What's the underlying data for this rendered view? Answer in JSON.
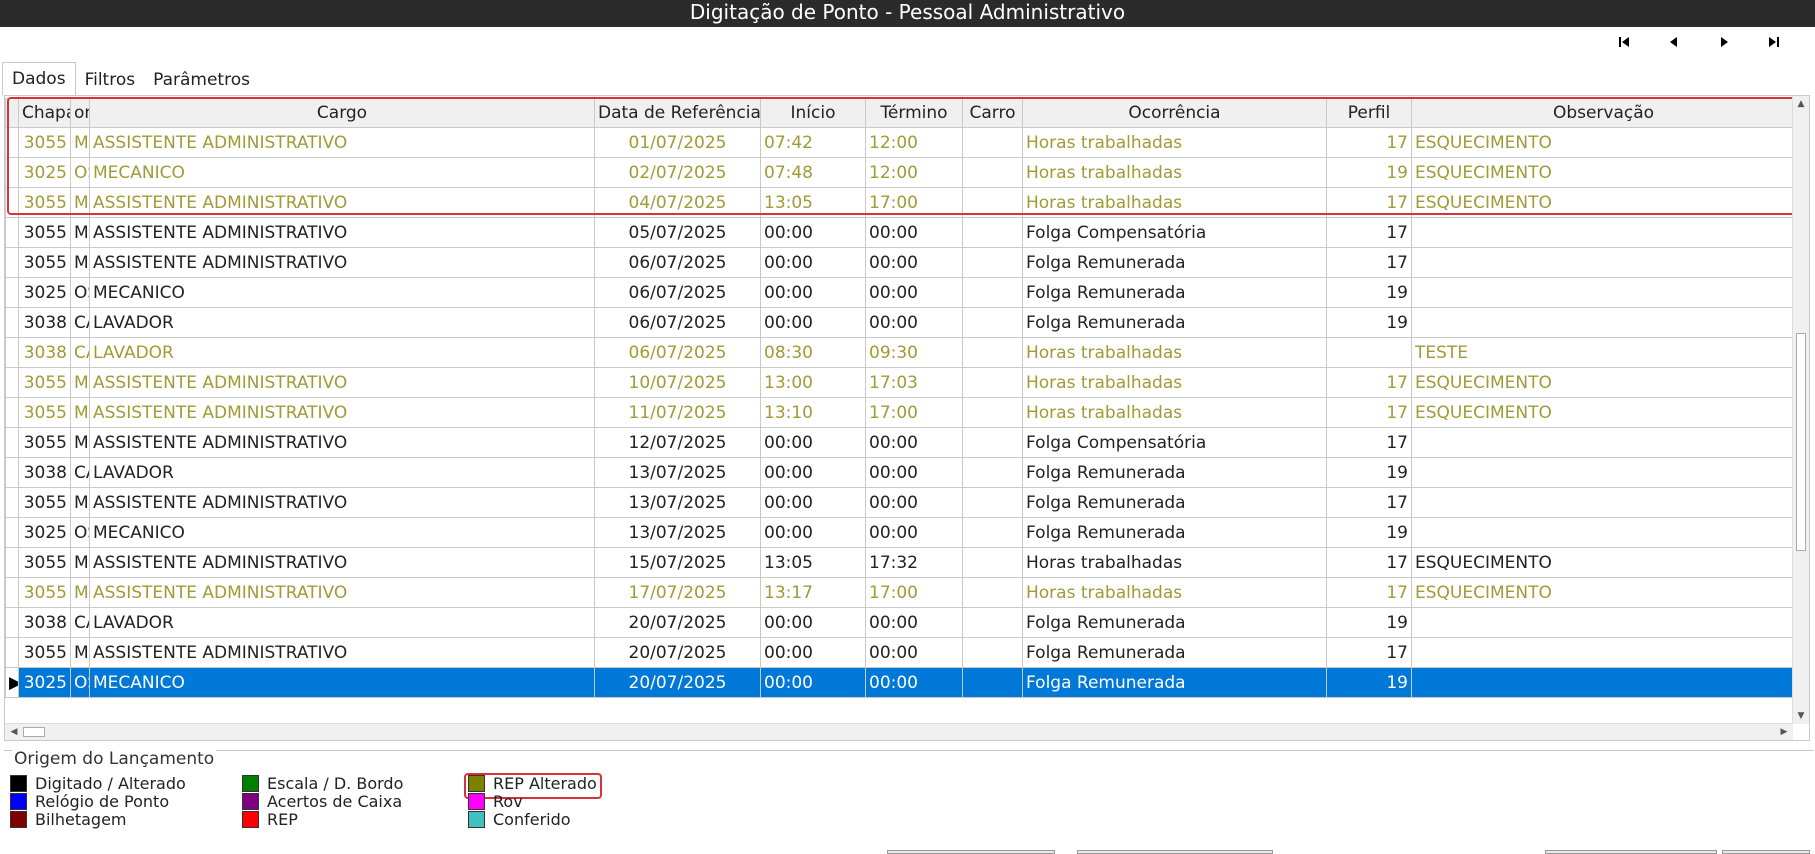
{
  "window": {
    "title": "Digitação de Ponto - Pessoal Administrativo"
  },
  "nav": {
    "icons": [
      "first-record-icon",
      "previous-record-icon",
      "next-record-icon",
      "last-record-icon"
    ]
  },
  "tabs": [
    {
      "label": "Dados",
      "active": true
    },
    {
      "label": "Filtros",
      "active": false
    },
    {
      "label": "Parâmetros",
      "active": false
    }
  ],
  "grid": {
    "columns": [
      "Chapa",
      "Nome",
      "Cargo",
      "Data de Referência",
      "Início",
      "Término",
      "Carro",
      "Ocorrência",
      "Perfil",
      "Observação"
    ],
    "column_header_display": [
      "Chapa",
      "om",
      "Cargo",
      "Data de Referência",
      "Início",
      "Término",
      "Carro",
      "Ocorrência",
      "Perfil",
      "Observação"
    ],
    "rows": [
      {
        "chapa": "3055",
        "nome": "M",
        "cargo": "ASSISTENTE ADMINISTRATIVO",
        "data": "01/07/2025",
        "inicio": "07:42",
        "termino": "12:00",
        "carro": "",
        "ocorrencia": "Horas trabalhadas",
        "perfil": "17",
        "observacao": "ESQUECIMENTO",
        "style": "olive"
      },
      {
        "chapa": "3025",
        "nome": "OS",
        "cargo": "MECANICO",
        "data": "02/07/2025",
        "inicio": "07:48",
        "termino": "12:00",
        "carro": "",
        "ocorrencia": "Horas trabalhadas",
        "perfil": "19",
        "observacao": "ESQUECIMENTO",
        "style": "olive"
      },
      {
        "chapa": "3055",
        "nome": "M",
        "cargo": "ASSISTENTE ADMINISTRATIVO",
        "data": "04/07/2025",
        "inicio": "13:05",
        "termino": "17:00",
        "carro": "",
        "ocorrencia": "Horas trabalhadas",
        "perfil": "17",
        "observacao": "ESQUECIMENTO",
        "style": "olive"
      },
      {
        "chapa": "3055",
        "nome": "M",
        "cargo": "ASSISTENTE ADMINISTRATIVO",
        "data": "05/07/2025",
        "inicio": "00:00",
        "termino": "00:00",
        "carro": "",
        "ocorrencia": "Folga Compensatória",
        "perfil": "17",
        "observacao": "",
        "style": "normal"
      },
      {
        "chapa": "3055",
        "nome": "M",
        "cargo": "ASSISTENTE ADMINISTRATIVO",
        "data": "06/07/2025",
        "inicio": "00:00",
        "termino": "00:00",
        "carro": "",
        "ocorrencia": "Folga Remunerada",
        "perfil": "17",
        "observacao": "",
        "style": "normal"
      },
      {
        "chapa": "3025",
        "nome": "OS",
        "cargo": "MECANICO",
        "data": "06/07/2025",
        "inicio": "00:00",
        "termino": "00:00",
        "carro": "",
        "ocorrencia": "Folga Remunerada",
        "perfil": "19",
        "observacao": "",
        "style": "normal"
      },
      {
        "chapa": "3038",
        "nome": "CA",
        "cargo": "LAVADOR",
        "data": "06/07/2025",
        "inicio": "00:00",
        "termino": "00:00",
        "carro": "",
        "ocorrencia": "Folga Remunerada",
        "perfil": "19",
        "observacao": "",
        "style": "normal"
      },
      {
        "chapa": "3038",
        "nome": "CA",
        "cargo": "LAVADOR",
        "data": "06/07/2025",
        "inicio": "08:30",
        "termino": "09:30",
        "carro": "",
        "ocorrencia": "Horas trabalhadas",
        "perfil": "",
        "observacao": "TESTE",
        "style": "olive"
      },
      {
        "chapa": "3055",
        "nome": "M",
        "cargo": "ASSISTENTE ADMINISTRATIVO",
        "data": "10/07/2025",
        "inicio": "13:00",
        "termino": "17:03",
        "carro": "",
        "ocorrencia": "Horas trabalhadas",
        "perfil": "17",
        "observacao": "ESQUECIMENTO",
        "style": "olive"
      },
      {
        "chapa": "3055",
        "nome": "M",
        "cargo": "ASSISTENTE ADMINISTRATIVO",
        "data": "11/07/2025",
        "inicio": "13:10",
        "termino": "17:00",
        "carro": "",
        "ocorrencia": "Horas trabalhadas",
        "perfil": "17",
        "observacao": "ESQUECIMENTO",
        "style": "olive"
      },
      {
        "chapa": "3055",
        "nome": "M",
        "cargo": "ASSISTENTE ADMINISTRATIVO",
        "data": "12/07/2025",
        "inicio": "00:00",
        "termino": "00:00",
        "carro": "",
        "ocorrencia": "Folga Compensatória",
        "perfil": "17",
        "observacao": "",
        "style": "normal"
      },
      {
        "chapa": "3038",
        "nome": "CA",
        "cargo": "LAVADOR",
        "data": "13/07/2025",
        "inicio": "00:00",
        "termino": "00:00",
        "carro": "",
        "ocorrencia": "Folga Remunerada",
        "perfil": "19",
        "observacao": "",
        "style": "normal"
      },
      {
        "chapa": "3055",
        "nome": "M",
        "cargo": "ASSISTENTE ADMINISTRATIVO",
        "data": "13/07/2025",
        "inicio": "00:00",
        "termino": "00:00",
        "carro": "",
        "ocorrencia": "Folga Remunerada",
        "perfil": "17",
        "observacao": "",
        "style": "normal"
      },
      {
        "chapa": "3025",
        "nome": "OS",
        "cargo": "MECANICO",
        "data": "13/07/2025",
        "inicio": "00:00",
        "termino": "00:00",
        "carro": "",
        "ocorrencia": "Folga Remunerada",
        "perfil": "19",
        "observacao": "",
        "style": "normal"
      },
      {
        "chapa": "3055",
        "nome": "M",
        "cargo": "ASSISTENTE ADMINISTRATIVO",
        "data": "15/07/2025",
        "inicio": "13:05",
        "termino": "17:32",
        "carro": "",
        "ocorrencia": "Horas trabalhadas",
        "perfil": "17",
        "observacao": "ESQUECIMENTO",
        "style": "normal"
      },
      {
        "chapa": "3055",
        "nome": "M",
        "cargo": "ASSISTENTE ADMINISTRATIVO",
        "data": "17/07/2025",
        "inicio": "13:17",
        "termino": "17:00",
        "carro": "",
        "ocorrencia": "Horas trabalhadas",
        "perfil": "17",
        "observacao": "ESQUECIMENTO",
        "style": "olive"
      },
      {
        "chapa": "3038",
        "nome": "CA",
        "cargo": "LAVADOR",
        "data": "20/07/2025",
        "inicio": "00:00",
        "termino": "00:00",
        "carro": "",
        "ocorrencia": "Folga Remunerada",
        "perfil": "19",
        "observacao": "",
        "style": "normal"
      },
      {
        "chapa": "3055",
        "nome": "M",
        "cargo": "ASSISTENTE ADMINISTRATIVO",
        "data": "20/07/2025",
        "inicio": "00:00",
        "termino": "00:00",
        "carro": "",
        "ocorrencia": "Folga Remunerada",
        "perfil": "17",
        "observacao": "",
        "style": "normal"
      },
      {
        "chapa": "3025",
        "nome": "OS",
        "cargo": "MECANICO",
        "data": "20/07/2025",
        "inicio": "00:00",
        "termino": "00:00",
        "carro": "",
        "ocorrencia": "Folga Remunerada",
        "perfil": "19",
        "observacao": "",
        "style": "selected"
      }
    ]
  },
  "legend": {
    "title": "Origem do Lançamento",
    "items": [
      {
        "label": "Digitado / Alterado",
        "color": "#000000"
      },
      {
        "label": "Relógio de Ponto",
        "color": "#0000ff"
      },
      {
        "label": "Bilhetagem",
        "color": "#800000"
      },
      {
        "label": "Escala / D. Bordo",
        "color": "#008000"
      },
      {
        "label": "Acertos de Caixa",
        "color": "#800080"
      },
      {
        "label": "REP",
        "color": "#ff0000"
      },
      {
        "label": "REP Alterado",
        "color": "#808000"
      },
      {
        "label": "Rov",
        "color": "#ff00ff"
      },
      {
        "label": "Conferido",
        "color": "#40c0c0"
      }
    ]
  },
  "colors": {
    "olive_text": "#a19a35",
    "selection": "#0078d7",
    "annotation": "#d7323c"
  }
}
